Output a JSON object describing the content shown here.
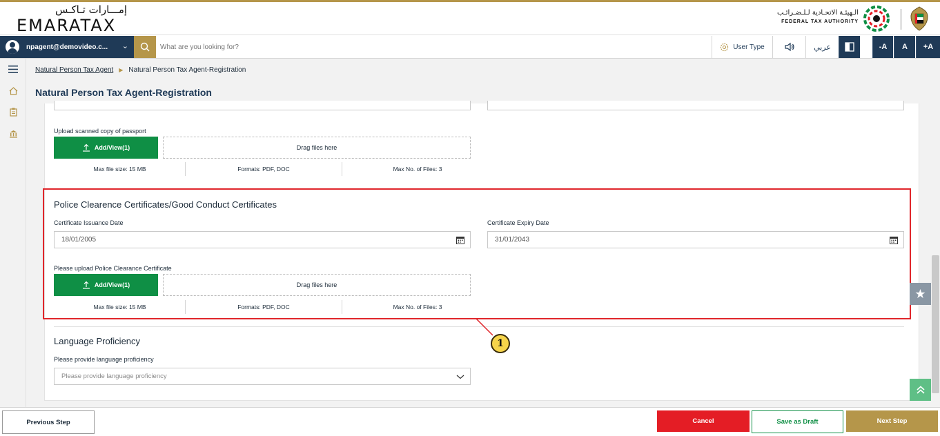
{
  "brand": {
    "logo_arabic": "إمـــارات تـاكـس",
    "logo_latin": "EMARATAX",
    "fta_arabic": "الـهيئـة الاتحـادية لـلـضـرائـب",
    "fta_english": "FEDERAL TAX AUTHORITY"
  },
  "toolbar": {
    "user_email": "npagent@demovideo.c...",
    "search_placeholder": "What are you looking for?",
    "user_type_label": "User Type",
    "language_label": "عربي",
    "font_decrease": "-A",
    "font_reset": "A",
    "font_increase": "+A"
  },
  "breadcrumb": {
    "parent": "Natural Person Tax Agent",
    "current": "Natural Person Tax Agent-Registration"
  },
  "page_title": "Natural Person Tax Agent-Registration",
  "passport_upload": {
    "label": "Upload scanned copy of passport",
    "button_label": "Add/View(1)",
    "drop_text": "Drag files here",
    "max_size": "Max file size: 15 MB",
    "formats": "Formats: PDF, DOC",
    "max_files": "Max No. of Files: 3"
  },
  "police_section": {
    "title": "Police Clearence Certificates/Good Conduct Certificates",
    "issuance_label": "Certificate Issuance Date",
    "issuance_value": "18/01/2005",
    "expiry_label": "Certificate Expiry Date",
    "expiry_value": "31/01/2043",
    "upload_label": "Please upload Police Clearance Certificate",
    "button_label": "Add/View(1)",
    "drop_text": "Drag files here",
    "max_size": "Max file size: 15 MB",
    "formats": "Formats: PDF, DOC",
    "max_files": "Max No. of Files: 3"
  },
  "callout_number": "1",
  "language_section": {
    "title": "Language Proficiency",
    "label": "Please provide language proficiency",
    "placeholder": "Please provide language proficiency"
  },
  "footer": {
    "previous": "Previous Step",
    "cancel": "Cancel",
    "save_draft": "Save as Draft",
    "next": "Next Step"
  },
  "colors": {
    "navy": "#1f3a57",
    "gold": "#b5964a",
    "green": "#0f8f45",
    "red": "#e41d25",
    "highlight": "#e0262b"
  }
}
